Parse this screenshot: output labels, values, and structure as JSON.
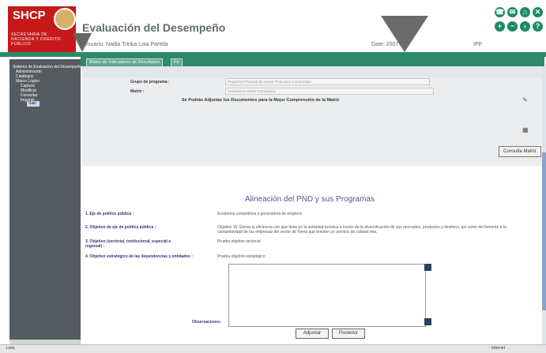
{
  "header": {
    "logo": "SHCP",
    "logo_subtitle": "SECRETARÍA DE HACIENDA Y CRÉDITO PÚBLICO",
    "app_title": "Evaluación del Desempeño",
    "user_label": "Usuario: Nadia Trinka Loia Partida",
    "date_label": "Date: 2007",
    "ipp_label": "IPP",
    "icons": [
      "phone-icon",
      "mail-icon",
      "home-icon",
      "close-icon",
      "plus-icon",
      "minus-icon",
      "back-icon",
      "help-icon"
    ]
  },
  "sidebar": {
    "items": [
      "Sistema de Evaluación del Desempeño",
      "Administración",
      "Catálogos",
      "Marco Lógico",
      "Captura",
      "Modificar",
      "Consultar",
      "Imprimir",
      "Salir"
    ]
  },
  "tabs": [
    "Matriz de Indicadores de Resultados",
    "Pp"
  ],
  "form": {
    "programa_label": "Grupo de programa :",
    "programa_value": "Programa Principal de Apoyo Financiero a Empresas",
    "matriz_label": "Matriz :",
    "matriz_value": "Generación Matriz Estratégica",
    "notice": "Se Podrán Adjuntar los Documentos para la Mejor Comprensión de la Matriz",
    "consult_button": "Consulta Matriz"
  },
  "alineacion": {
    "title": "Alineación del PND y sus Programas",
    "rows": [
      {
        "label": "1. Eje de política pública :",
        "value": "Economía competitiva y generadora de empleos"
      },
      {
        "label": "2. Objetivo de eje de política pública :",
        "value": "Objetivo 15: Elevar la eficiencia con que tiene en la actividad turística a través de la diversificación de sus mercados, productos y destinos, así como del fomento a la competitividad de las empresas del sector de forma que brinden un servicio de calidad mia."
      },
      {
        "label": "3. Objetivo (sectorial, institucional, especial o regional) :",
        "value": "Prueba objetivo sectorial"
      },
      {
        "label": "4. Objetivo estratégico de las dependencias y entidades :",
        "value": "Prueba objetivo estratégico"
      }
    ],
    "observaciones_label": "Observaciones",
    "observaciones_value": "",
    "buttons": {
      "adjuntar": "Adjuntar",
      "posterior": "Posterior"
    }
  },
  "status": {
    "left": "Listo",
    "right": "Internet"
  }
}
